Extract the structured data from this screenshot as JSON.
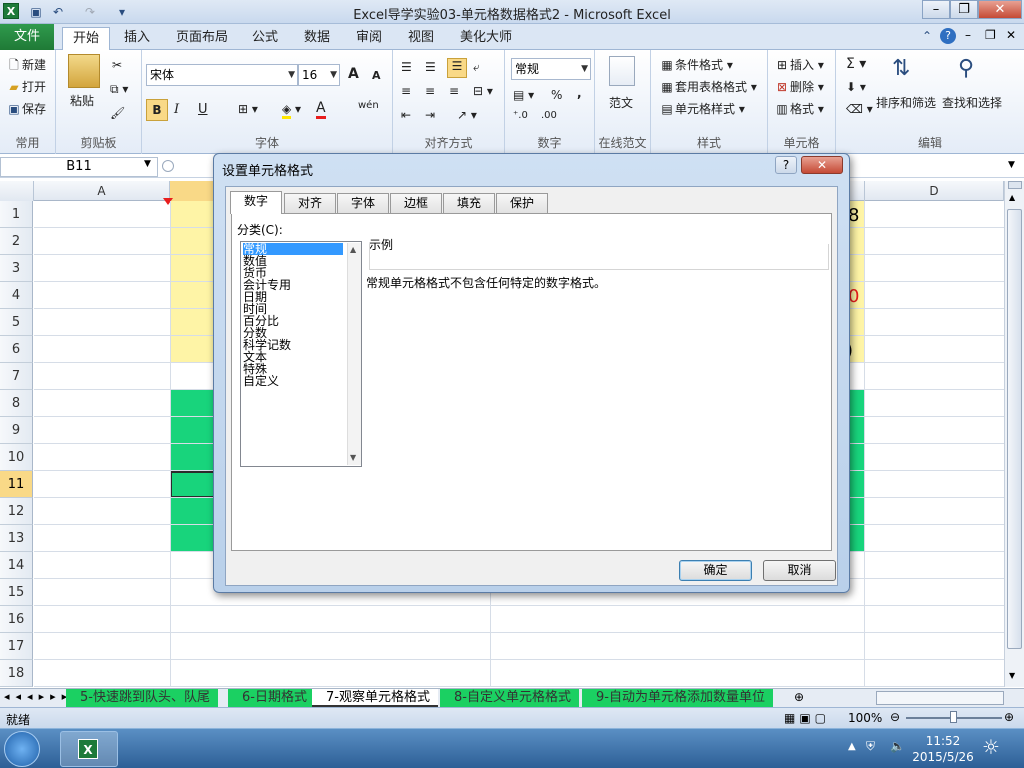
{
  "window": {
    "title": "Excel导学实验03-单元格数据格式2 - Microsoft Excel",
    "minimize": "–",
    "restore": "❐",
    "close": "✕"
  },
  "quick_access": {
    "app_icon": "X",
    "undo": "↶",
    "redo": "↷"
  },
  "ribbon_tabs": [
    "文件",
    "开始",
    "插入",
    "页面布局",
    "公式",
    "数据",
    "审阅",
    "视图",
    "美化大师"
  ],
  "ribbon": {
    "clipboard": {
      "new": "新建",
      "open": "打开",
      "save": "保存",
      "paste": "粘贴",
      "label_common": "常用",
      "label": "剪贴板"
    },
    "font": {
      "name": "宋体",
      "size": "16",
      "bold": "B",
      "italic": "I",
      "underline": "U",
      "grow": "A",
      "shrink": "A",
      "font_color": "A",
      "phonetic": "wén",
      "label": "字体"
    },
    "alignment": {
      "label": "对齐方式"
    },
    "number": {
      "format": "常规",
      "percent": "%",
      "comma": ",",
      "label": "数字"
    },
    "online": {
      "sample": "范文",
      "label": "在线范文"
    },
    "styles": {
      "cond": "条件格式",
      "table": "套用表格格式",
      "cell": "单元格样式",
      "label": "样式"
    },
    "cells": {
      "insert": "插入",
      "delete": "删除",
      "format": "格式",
      "label": "单元格"
    },
    "editing": {
      "sum": "Σ",
      "sort": "排序和筛选",
      "find": "查找和选择",
      "label": "编辑"
    }
  },
  "formula_bar": {
    "name_box": "B11"
  },
  "columns": [
    "A",
    "D"
  ],
  "rows": [
    "1",
    "2",
    "3",
    "4",
    "5",
    "6",
    "7",
    "8",
    "9",
    "10",
    "11",
    "12",
    "13",
    "14",
    "15",
    "16",
    "17",
    "18"
  ],
  "cell_fragments": {
    "r1": "8",
    "r4": "0",
    "r6": ")"
  },
  "sheet_tabs": [
    "5-快速跳到队头、队尾",
    "6-日期格式",
    "7-观察单元格格式",
    "8-自定义单元格格式",
    "9-自动为单元格添加数量单位"
  ],
  "status": {
    "ready": "就绪",
    "zoom": "100%"
  },
  "taskbar": {
    "time": "11:52",
    "date": "2015/5/26"
  },
  "dialog": {
    "title": "设置单元格格式",
    "help": "?",
    "close": "✕",
    "tabs": [
      "数字",
      "对齐",
      "字体",
      "边框",
      "填充",
      "保护"
    ],
    "category_label": "分类(C):",
    "categories": [
      "常规",
      "数值",
      "货币",
      "会计专用",
      "日期",
      "时间",
      "百分比",
      "分数",
      "科学记数",
      "文本",
      "特殊",
      "自定义"
    ],
    "sample_label": "示例",
    "description": "常规单元格格式不包含任何特定的数字格式。",
    "ok": "确定",
    "cancel": "取消"
  },
  "colors": {
    "file_tab": "#1f7a36",
    "yellow_fill": "#fef4a6",
    "green_fill": "#18d47c",
    "selected_row": "#f9d987"
  }
}
